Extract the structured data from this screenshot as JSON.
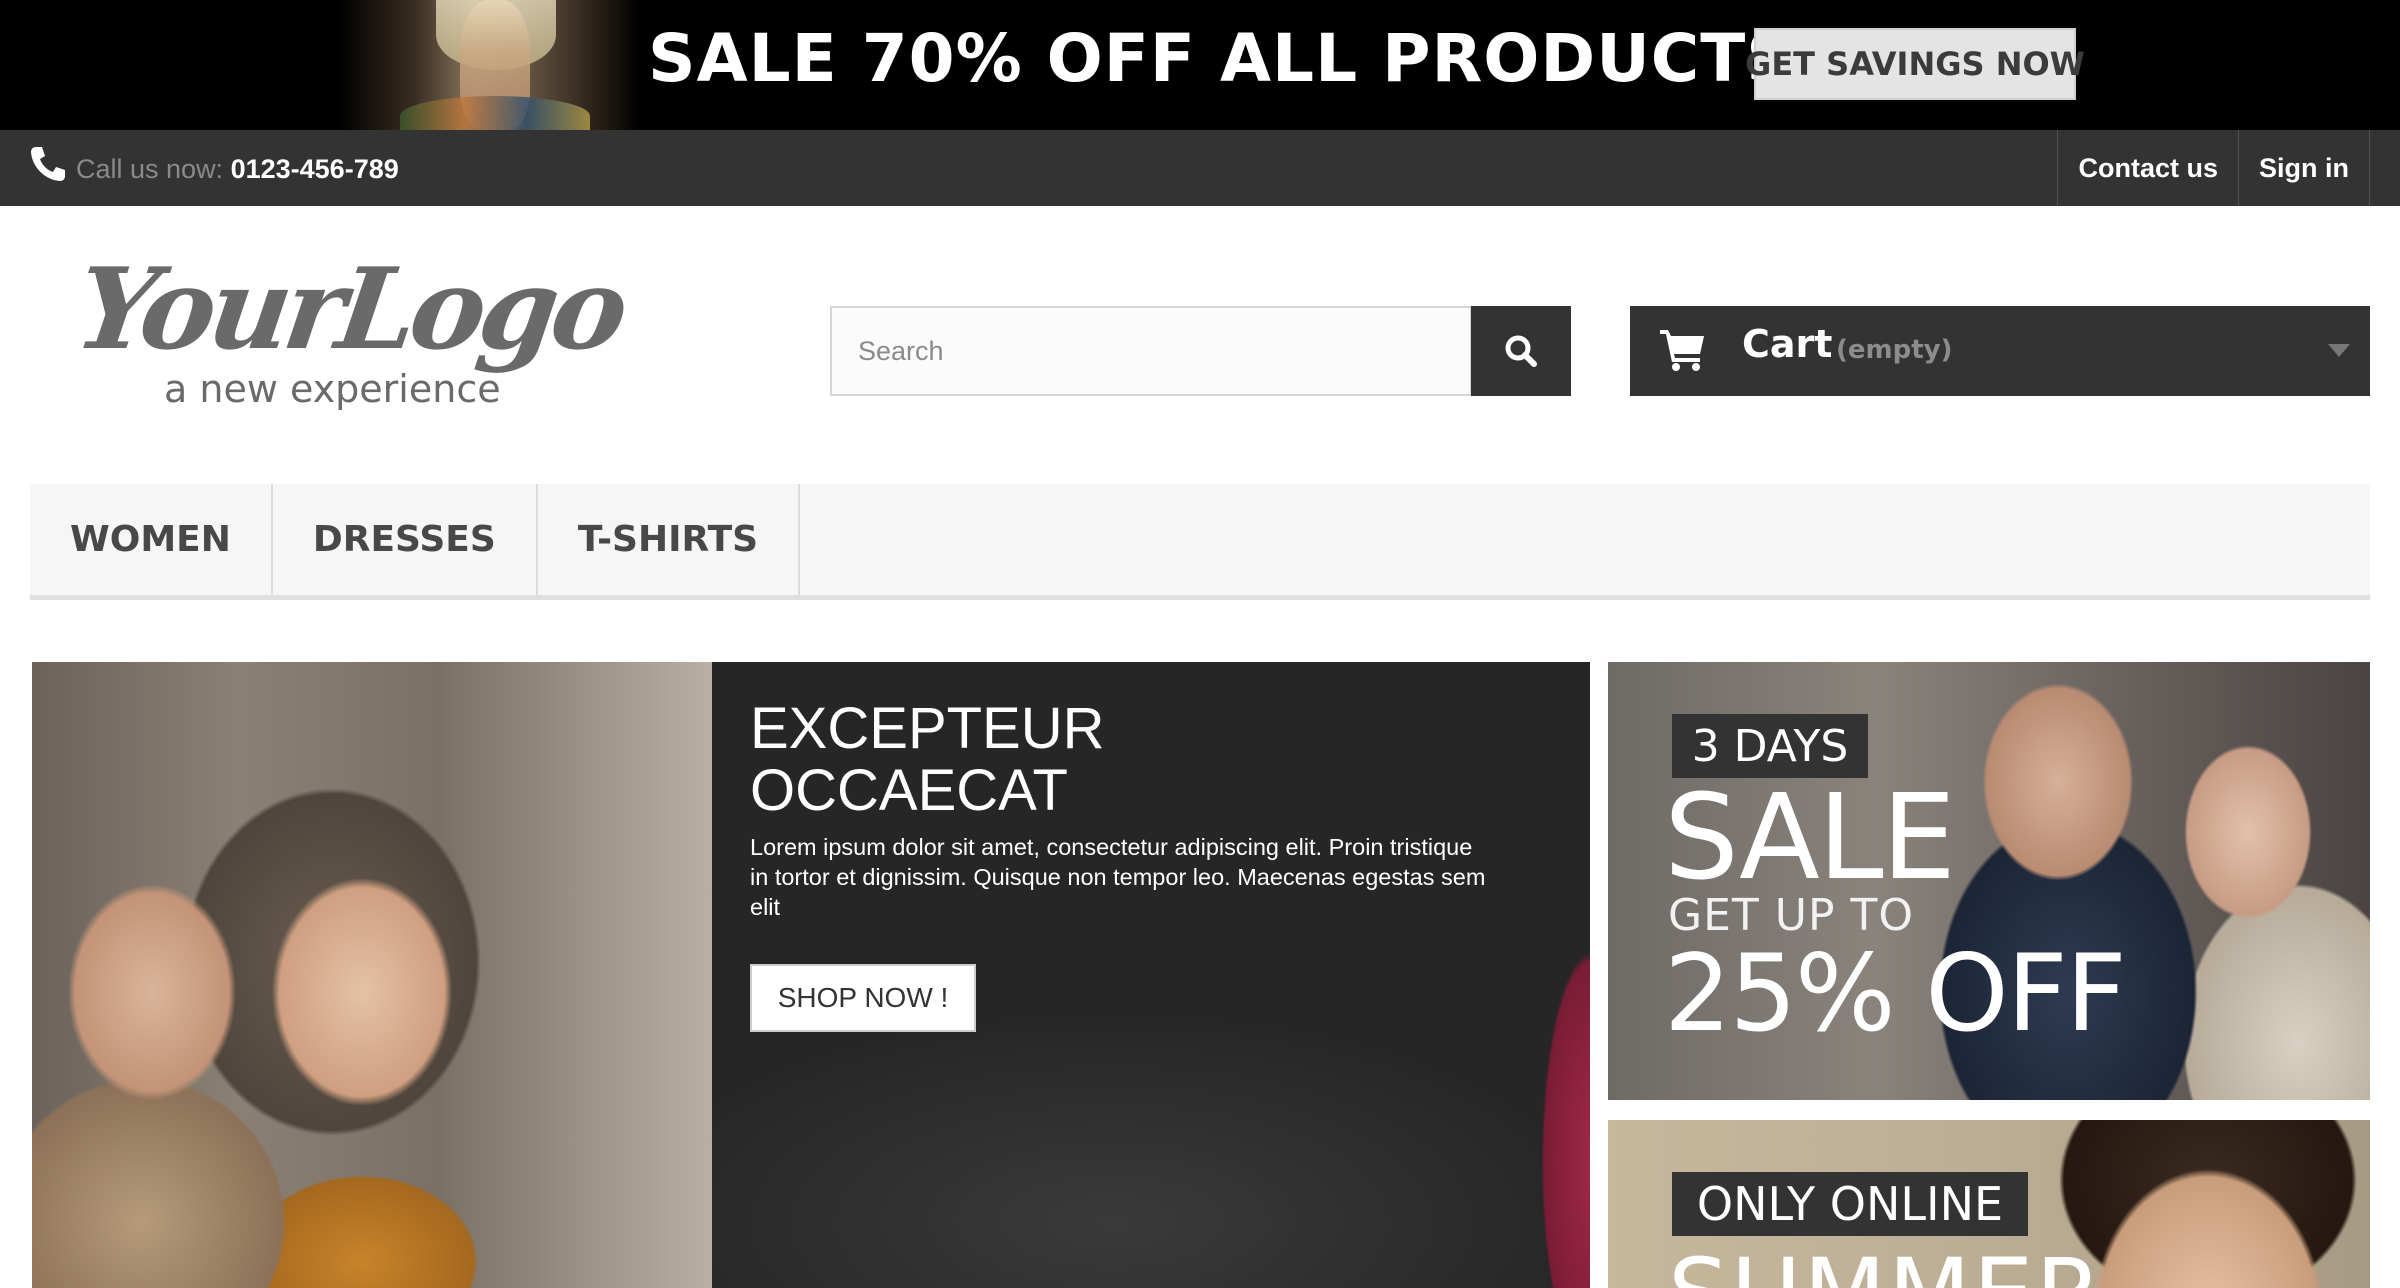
{
  "promo": {
    "headline": "SALE 70% OFF ALL PRODUCTS",
    "button_label": "GET SAVINGS NOW"
  },
  "topbar": {
    "call_label": "Call us now:",
    "phone": "0123-456-789",
    "links": [
      "Contact us",
      "Sign in"
    ]
  },
  "header": {
    "logo_main": "YourLogo",
    "logo_tagline": "a new experience",
    "search_placeholder": "Search",
    "cart_label": "Cart",
    "cart_status": "(empty)"
  },
  "menu": {
    "items": [
      "WOMEN",
      "DRESSES",
      "T-SHIRTS"
    ]
  },
  "slider": {
    "title_line1": "EXCEPTEUR",
    "title_line2": "OCCAECAT",
    "text": "Lorem ipsum dolor sit amet, consectetur adipiscing elit. Proin tristique in tortor et dignissim. Quisque non tempor leo. Maecenas egestas sem elit",
    "button_label": "SHOP NOW !"
  },
  "banner1": {
    "tag": "3 DAYS",
    "sale": "SALE",
    "get_up_to": "GET UP TO",
    "discount": "25% OFF"
  },
  "banner2": {
    "tag": "ONLY ONLINE",
    "headline": "SUMMER"
  },
  "colors": {
    "dark": "#333333",
    "menu_bg": "#f6f6f6",
    "muted": "#8a8a8a"
  }
}
